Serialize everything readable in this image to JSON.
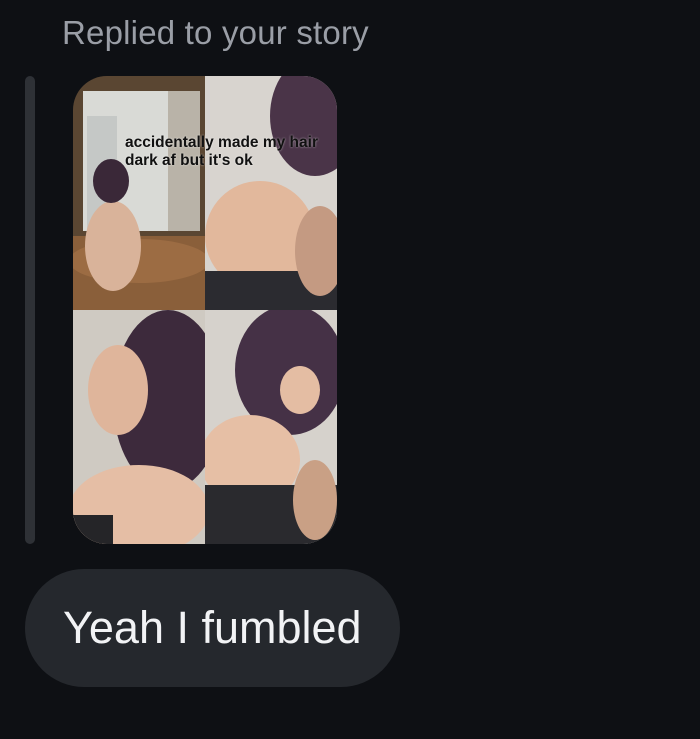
{
  "reply": {
    "header": "Replied to your story"
  },
  "story": {
    "caption": "accidentally made my hair dark af but it's ok",
    "tiles": [
      "photo-top-left",
      "photo-top-right",
      "photo-bottom-left",
      "photo-bottom-right"
    ]
  },
  "message": {
    "text": "Yeah I fumbled"
  },
  "colors": {
    "background": "#0e1014",
    "bubble": "#25282d",
    "header_text": "#9a9ea6",
    "message_text": "#f2f3f5"
  }
}
